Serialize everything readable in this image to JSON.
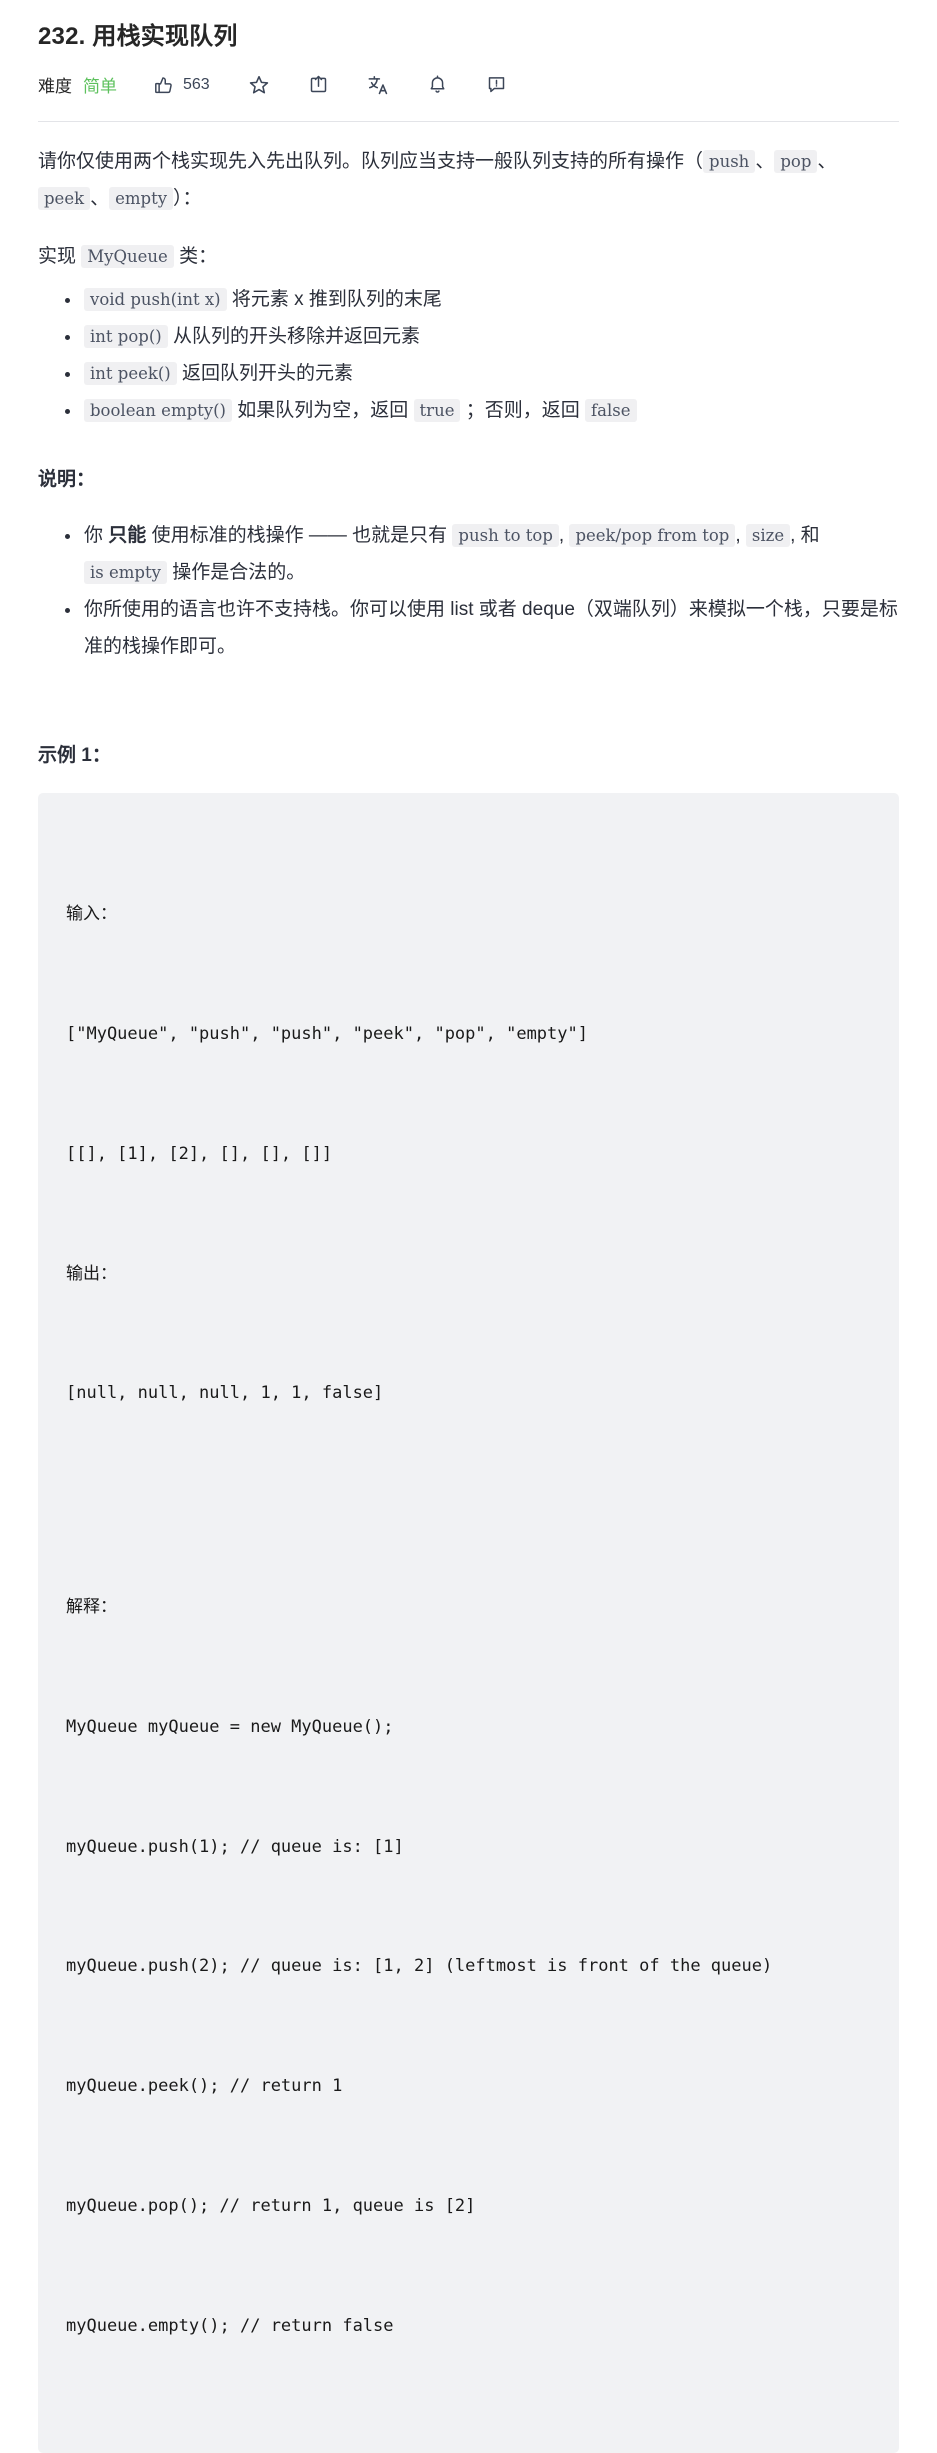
{
  "header": {
    "title": "232. 用栈实现队列",
    "difficulty_label": "难度",
    "difficulty_value": "简单",
    "difficulty_color": "#5dc15d",
    "like_count": "563",
    "actions": [
      {
        "icon": "thumbs-up-icon",
        "label": "563"
      },
      {
        "icon": "star-icon",
        "label": ""
      },
      {
        "icon": "share-icon",
        "label": ""
      },
      {
        "icon": "translate-icon",
        "label": ""
      },
      {
        "icon": "bell-icon",
        "label": ""
      },
      {
        "icon": "feedback-icon",
        "label": ""
      }
    ]
  },
  "description": {
    "intro_a": "请你仅使用两个栈实现先入先出队列。队列应当支持一般队列支持的所有操作（",
    "intro_code_1": "push",
    "intro_sep_1": "、",
    "intro_code_2": "pop",
    "intro_sep_2": "、",
    "intro_code_3": "peek",
    "intro_sep_3": "、",
    "intro_code_4": "empty",
    "intro_b": "）：",
    "impl_prefix": "实现 ",
    "impl_code": "MyQueue",
    "impl_suffix": " 类：",
    "methods": [
      {
        "code": "void push(int x)",
        "text": " 将元素 x 推到队列的末尾"
      },
      {
        "code": "int pop()",
        "text": " 从队列的开头移除并返回元素"
      },
      {
        "code": "int peek()",
        "text": " 返回队列开头的元素"
      }
    ],
    "method_empty": {
      "code": "boolean empty()",
      "text_a": " 如果队列为空，返回 ",
      "code_true": "true",
      "text_b": " ；否则，返回 ",
      "code_false": "false"
    }
  },
  "notes": {
    "heading": "说明：",
    "item1": {
      "a": "你 ",
      "bold": "只能",
      "b": " 使用标准的栈操作 —— 也就是只有 ",
      "code1": "push to top",
      "sep1": ", ",
      "code2": "peek/pop from top",
      "sep2": ", ",
      "code3": "size",
      "sep3": ", 和 ",
      "code4": "is empty",
      "c": " 操作是合法的。"
    },
    "item2": "你所使用的语言也许不支持栈。你可以使用 list 或者 deque（双端队列）来模拟一个栈，只要是标准的栈操作即可。"
  },
  "example": {
    "heading": "示例 1：",
    "lines": [
      "输入：",
      "[\"MyQueue\", \"push\", \"push\", \"peek\", \"pop\", \"empty\"]",
      "[[], [1], [2], [], [], []]",
      "输出：",
      "[null, null, null, 1, 1, false]",
      "",
      "解释：",
      "MyQueue myQueue = new MyQueue();",
      "myQueue.push(1); // queue is: [1]",
      "myQueue.push(2); // queue is: [1, 2] (leftmost is front of the queue)",
      "myQueue.peek(); // return 1",
      "myQueue.pop(); // return 1, queue is [2]",
      "myQueue.empty(); // return false"
    ]
  }
}
